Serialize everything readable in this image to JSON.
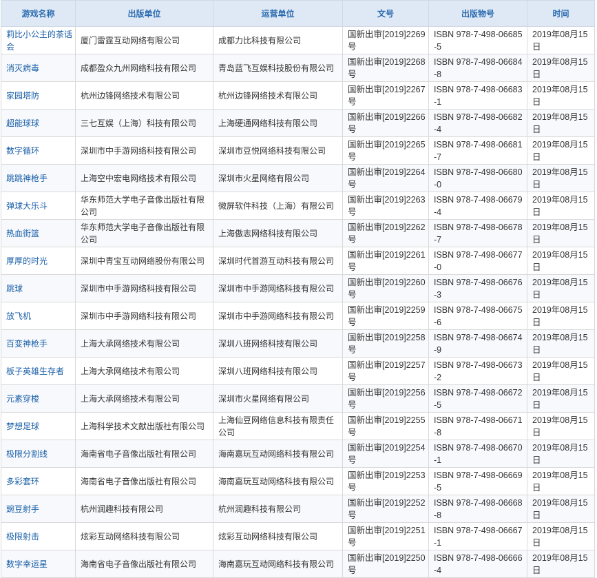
{
  "headers": [
    "游戏名称",
    "出版单位",
    "运营单位",
    "文号",
    "出版物号",
    "时间"
  ],
  "rows": [
    {
      "name": "莉比小公主的茶话会",
      "publisher": "厦门雷霆互动网络有限公司",
      "operator": "成都力比科技有限公司",
      "code": "国新出审[2019]2269号",
      "isbn": "ISBN 978-7-498-06685-5",
      "date": "2019年08月15日"
    },
    {
      "name": "消灭病毒",
      "publisher": "成都盈众九州网络科技有限公司",
      "operator": "青岛蓝飞互娱科技股份有限公司",
      "code": "国新出审[2019]2268号",
      "isbn": "ISBN 978-7-498-06684-8",
      "date": "2019年08月15日"
    },
    {
      "name": "家园塔防",
      "publisher": "杭州边锋网络技术有限公司",
      "operator": "杭州边锋网络技术有限公司",
      "code": "国新出审[2019]2267号",
      "isbn": "ISBN 978-7-498-06683-1",
      "date": "2019年08月15日"
    },
    {
      "name": "超能球球",
      "publisher": "三七互娱（上海）科技有限公司",
      "operator": "上海硬通网络科技有限公司",
      "code": "国新出审[2019]2266号",
      "isbn": "ISBN 978-7-498-06682-4",
      "date": "2019年08月15日"
    },
    {
      "name": "数字循环",
      "publisher": "深圳市中手游网络科技有限公司",
      "operator": "深圳市豆悦网络科技有限公司",
      "code": "国新出审[2019]2265号",
      "isbn": "ISBN 978-7-498-06681-7",
      "date": "2019年08月15日"
    },
    {
      "name": "跳跳神枪手",
      "publisher": "上海空中宏电网络技术有限公司",
      "operator": "深圳市火星网络有限公司",
      "code": "国新出审[2019]2264号",
      "isbn": "ISBN 978-7-498-06680-0",
      "date": "2019年08月15日"
    },
    {
      "name": "弹球大乐斗",
      "publisher": "华东师范大学电子音像出版社有限公司",
      "operator": "微屏软件科技（上海）有限公司",
      "code": "国新出审[2019]2263号",
      "isbn": "ISBN 978-7-498-06679-4",
      "date": "2019年08月15日"
    },
    {
      "name": "热血街篮",
      "publisher": "华东师范大学电子音像出版社有限公司",
      "operator": "上海傲志网络科技有限公司",
      "code": "国新出审[2019]2262号",
      "isbn": "ISBN 978-7-498-06678-7",
      "date": "2019年08月15日"
    },
    {
      "name": "厚厚的时光",
      "publisher": "深圳中青宝互动网络股份有限公司",
      "operator": "深圳时代首游互动科技有限公司",
      "code": "国新出审[2019]2261号",
      "isbn": "ISBN 978-7-498-06677-0",
      "date": "2019年08月15日"
    },
    {
      "name": "跳球",
      "publisher": "深圳市中手游网络科技有限公司",
      "operator": "深圳市中手游网络科技有限公司",
      "code": "国新出审[2019]2260号",
      "isbn": "ISBN 978-7-498-06676-3",
      "date": "2019年08月15日"
    },
    {
      "name": "放飞机",
      "publisher": "深圳市中手游网络科技有限公司",
      "operator": "深圳市中手游网络科技有限公司",
      "code": "国新出审[2019]2259号",
      "isbn": "ISBN 978-7-498-06675-6",
      "date": "2019年08月15日"
    },
    {
      "name": "百变神枪手",
      "publisher": "上海大承网络技术有限公司",
      "operator": "深圳八班网络科技有限公司",
      "code": "国新出审[2019]2258号",
      "isbn": "ISBN 978-7-498-06674-9",
      "date": "2019年08月15日"
    },
    {
      "name": "板子英雄生存者",
      "publisher": "上海大承网络技术有限公司",
      "operator": "深圳八班网络科技有限公司",
      "code": "国新出审[2019]2257号",
      "isbn": "ISBN 978-7-498-06673-2",
      "date": "2019年08月15日"
    },
    {
      "name": "元素穿梭",
      "publisher": "上海大承网络技术有限公司",
      "operator": "深圳市火星网络有限公司",
      "code": "国新出审[2019]2256号",
      "isbn": "ISBN 978-7-498-06672-5",
      "date": "2019年08月15日"
    },
    {
      "name": "梦想足球",
      "publisher": "上海科学技术文献出版社有限公司",
      "operator": "上海仙豆网络信息科技有限责任公司",
      "code": "国新出审[2019]2255号",
      "isbn": "ISBN 978-7-498-06671-8",
      "date": "2019年08月15日"
    },
    {
      "name": "极限分割线",
      "publisher": "海南省电子音像出版社有限公司",
      "operator": "海南嘉玩互动网络科技有限公司",
      "code": "国新出审[2019]2254号",
      "isbn": "ISBN 978-7-498-06670-1",
      "date": "2019年08月15日"
    },
    {
      "name": "多彩套环",
      "publisher": "海南省电子音像出版社有限公司",
      "operator": "海南嘉玩互动网络科技有限公司",
      "code": "国新出审[2019]2253号",
      "isbn": "ISBN 978-7-498-06669-5",
      "date": "2019年08月15日"
    },
    {
      "name": "豌豆射手",
      "publisher": "杭州润趣科技有限公司",
      "operator": "杭州润趣科技有限公司",
      "code": "国新出审[2019]2252号",
      "isbn": "ISBN 978-7-498-06668-8",
      "date": "2019年08月15日"
    },
    {
      "name": "极限射击",
      "publisher": "炫彩互动网络科技有限公司",
      "operator": "炫彩互动网络科技有限公司",
      "code": "国新出审[2019]2251号",
      "isbn": "ISBN 978-7-498-06667-1",
      "date": "2019年08月15日"
    },
    {
      "name": "数字幸运星",
      "publisher": "海南省电子音像出版社有限公司",
      "operator": "海南嘉玩互动网络科技有限公司",
      "code": "国新出审[2019]2250号",
      "isbn": "ISBN 978-7-498-06666-4",
      "date": "2019年08月15日"
    }
  ]
}
